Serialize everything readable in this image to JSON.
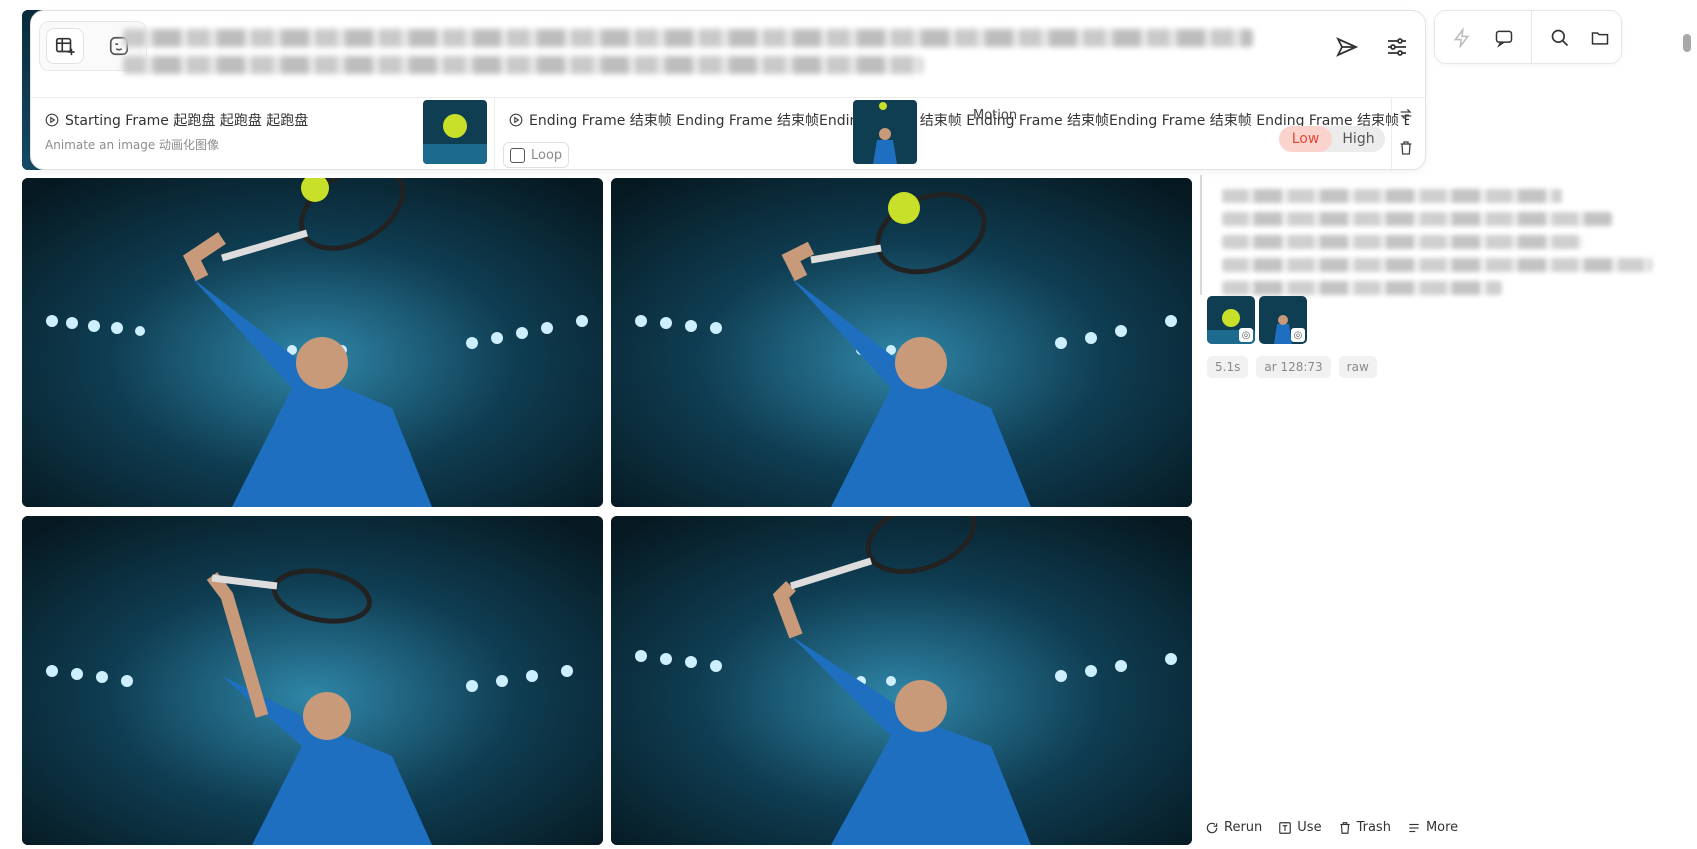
{
  "prompt": {
    "mode_buttons": [
      {
        "icon": "image-add-icon"
      },
      {
        "icon": "face-icon"
      }
    ]
  },
  "frames": {
    "starting": {
      "title": "Starting Frame  起跑盘  起跑盘 起跑盘",
      "subtitle": "Animate an image  动画化图像"
    },
    "ending": {
      "title": "Ending Frame  结束帧  Ending Frame 结束帧Ending Frame 结束帧 Ending Frame 结束帧Ending Frame 结束帧 Ending Frame 结束帧 Ending Frame 结束帧 Ending Frame 结束帧结束帧 结",
      "loop_label": "Loop"
    },
    "motion": {
      "label": "Motion",
      "options": [
        "Low",
        "High"
      ],
      "selected": "Low"
    }
  },
  "details": {
    "tags": [
      "5.1s",
      "ar 128:73",
      "raw"
    ]
  },
  "actions": [
    {
      "label": "Rerun",
      "icon": "rerun-icon"
    },
    {
      "label": "Use",
      "icon": "use-icon"
    },
    {
      "label": "Trash",
      "icon": "trash-icon"
    },
    {
      "label": "More",
      "icon": "more-icon"
    }
  ],
  "colors": {
    "accent": "#e44a35",
    "accent_bg": "#fbd3cd",
    "stadium_dark": "#07202c",
    "shirt_blue": "#1f6fc0"
  }
}
